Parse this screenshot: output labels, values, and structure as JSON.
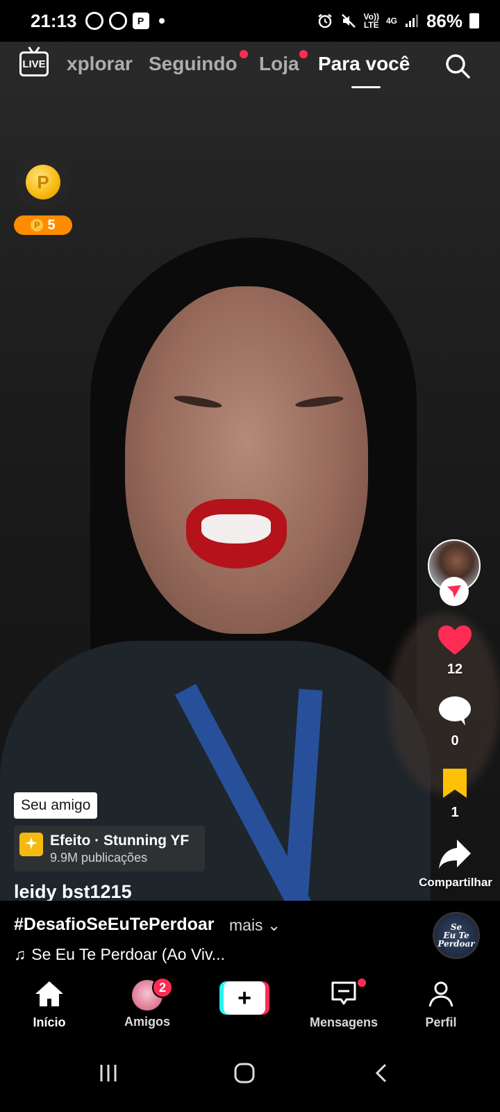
{
  "status_bar": {
    "time": "21:13",
    "battery": "86%",
    "network_top": "Vo))",
    "network_bottom": "LTE",
    "signal_label": "4G"
  },
  "top_nav": {
    "live_label": "LIVE",
    "tabs": [
      {
        "label": "xplorar",
        "active": false,
        "dot": false
      },
      {
        "label": "Seguindo",
        "active": false,
        "dot": true
      },
      {
        "label": "Loja",
        "active": false,
        "dot": true
      },
      {
        "label": "Para você",
        "active": true,
        "dot": false
      }
    ]
  },
  "reward": {
    "coin_letter": "P",
    "coin_count": "5"
  },
  "actions": {
    "likes": "12",
    "comments": "0",
    "saves": "1",
    "share_label": "Compartilhar"
  },
  "post": {
    "friend_tag": "Seu amigo",
    "effect_title": "Efeito · Stunning YF",
    "effect_sub": "9.9M publicações",
    "username": "leidy bst1215",
    "hashtag": "#DesafioSeEuTePerdoar",
    "more_label": "mais",
    "music": "Se Eu Te Perdoar (Ao Viv...",
    "disc_text_1": "Se",
    "disc_text_2": "Eu Te",
    "disc_text_3": "Perdoar"
  },
  "bottom_nav": {
    "home": "Início",
    "friends": "Amigos",
    "friends_badge": "2",
    "messages": "Mensagens",
    "profile": "Perfil"
  },
  "colors": {
    "accent": "#fe2c55",
    "cyan": "#25f4ee",
    "coin": "#ff8c00",
    "bookmark": "#ffc107"
  }
}
